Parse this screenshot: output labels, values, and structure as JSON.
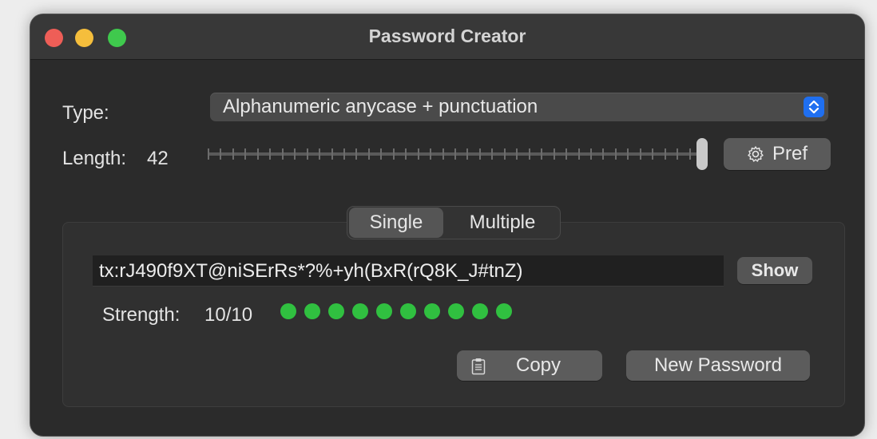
{
  "window": {
    "title": "Password Creator"
  },
  "type": {
    "label": "Type:",
    "selected": "Alphanumeric anycase + punctuation"
  },
  "length": {
    "label": "Length:",
    "value": "42",
    "slider_fraction": 1.0
  },
  "pref_button": {
    "label": "Pref",
    "icon": "gear-icon"
  },
  "mode_tabs": [
    {
      "label": "Single",
      "selected": true
    },
    {
      "label": "Multiple",
      "selected": false
    }
  ],
  "password": {
    "value": "tx:rJ490f9XT@niSErRs*?%+yh(BxR(rQ8K_J#tnZ)"
  },
  "show_button": {
    "label": "Show"
  },
  "strength": {
    "label": "Strength:",
    "value": "10/10",
    "dots_filled": 10,
    "dots_total": 10,
    "color": "#30c040"
  },
  "actions": {
    "copy_label": "Copy",
    "copy_icon": "clipboard-icon",
    "new_password_label": "New Password"
  }
}
